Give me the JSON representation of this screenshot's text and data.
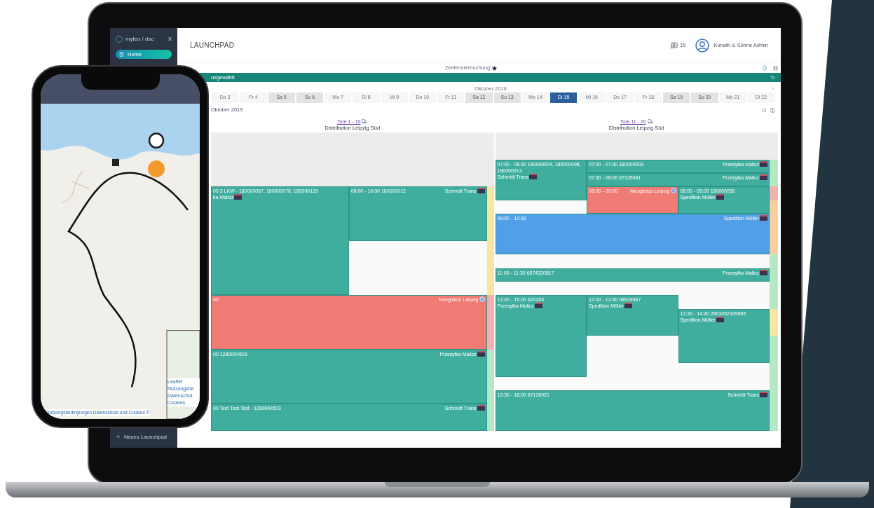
{
  "sidebar": {
    "logo": "myleo / dsc",
    "close": "X",
    "items": [
      {
        "label": "Home",
        "selected": true
      }
    ],
    "footer_action": "Neues Launchpad"
  },
  "header": {
    "title": "LAUNCHPAD",
    "messages": "15",
    "user": "Kunath & Söhne Admin"
  },
  "subheader": {
    "title": "Zeitfensterbuchung"
  },
  "filter_bar": {
    "text": "usgewählt"
  },
  "calendar": {
    "month": "Oktober 2019",
    "days": [
      {
        "label": "Do 3",
        "weekend": false,
        "selected": false
      },
      {
        "label": "Fr 4",
        "weekend": false,
        "selected": false
      },
      {
        "label": "Sa 5",
        "weekend": true,
        "selected": false
      },
      {
        "label": "So 6",
        "weekend": true,
        "selected": false
      },
      {
        "label": "Mo 7",
        "weekend": false,
        "selected": false
      },
      {
        "label": "Di 8",
        "weekend": false,
        "selected": false
      },
      {
        "label": "Mi 9",
        "weekend": false,
        "selected": false
      },
      {
        "label": "Do 10",
        "weekend": false,
        "selected": false
      },
      {
        "label": "Fr 11",
        "weekend": false,
        "selected": false
      },
      {
        "label": "Sa 12",
        "weekend": true,
        "selected": false
      },
      {
        "label": "So 13",
        "weekend": true,
        "selected": false
      },
      {
        "label": "Mo 14",
        "weekend": false,
        "selected": false
      },
      {
        "label": "Di 15",
        "weekend": false,
        "selected": true
      },
      {
        "label": "Mi 16",
        "weekend": false,
        "selected": false
      },
      {
        "label": "Do 17",
        "weekend": false,
        "selected": false
      },
      {
        "label": "Fr 18",
        "weekend": false,
        "selected": false
      },
      {
        "label": "Sa 19",
        "weekend": true,
        "selected": false
      },
      {
        "label": "So 20",
        "weekend": true,
        "selected": false
      },
      {
        "label": "Mo 21",
        "weekend": false,
        "selected": false
      },
      {
        "label": "Di 22",
        "weekend": false,
        "selected": false
      }
    ]
  },
  "schedule": {
    "date_label": "Oktober 2019",
    "columns": [
      {
        "gates": "Tore 1 - 10",
        "site": "Distribution Leipzig Süd",
        "events": [
          {
            "kind": "booked",
            "text": "00 3 LKW - 180000067, 180000078, 180000129",
            "carrier": "ka Malicz"
          },
          {
            "kind": "booked",
            "text": "08:00 - 10:00 180000012",
            "carrier": "Schmidt Trans"
          },
          {
            "kind": "blocked",
            "text": "00",
            "carrier": "Neogistics Leipzig"
          },
          {
            "kind": "booked",
            "text": "00 1280004503",
            "carrier": "Przesyłka Malicz"
          },
          {
            "kind": "booked",
            "text": "00 Test Test Test - 1280004503",
            "carrier": "Schmidt Trans"
          }
        ],
        "capacity": [
          {
            "color": "#f7e6a0"
          },
          {
            "color": "#f2b0b0"
          },
          {
            "color": "#b5e8c4"
          }
        ]
      },
      {
        "gates": "Tore 11 - 20",
        "site": "Distribution Leipzig Süd",
        "events": [
          {
            "kind": "booked",
            "text": "07:00 - 08:30 180000004, 180000098, 180000013",
            "carrier": "Schmidt Trans"
          },
          {
            "kind": "booked",
            "text": "07:00 - 07:30 180000003",
            "carrier": "Przesyłka Malicz"
          },
          {
            "kind": "booked",
            "text": "07:30 - 08:00 67125541",
            "carrier": "Przesyłka Malicz"
          },
          {
            "kind": "blocked",
            "text": "08:00 - 09:00",
            "carrier": "Neogistics Leipzig"
          },
          {
            "kind": "booked",
            "text": "08:00 - 09:00 180000056",
            "carrier": "Spedition Müller"
          },
          {
            "kind": "reserved",
            "text": "09:00 - 10:30",
            "carrier": "Spedition Müller"
          },
          {
            "kind": "booked",
            "text": "11:00 - 11:30 6574320817",
            "carrier": "Przesyłka Malicz"
          },
          {
            "kind": "booked",
            "text": "12:00 - 15:00 620335",
            "carrier": "Przesyłka Malicz"
          },
          {
            "kind": "booked",
            "text": "12:00 - 12:30 08919967",
            "carrier": "Spedition Müller"
          },
          {
            "kind": "booked",
            "text": "12:30 - 14:30 2803452345685",
            "carrier": "Spedition Müller"
          },
          {
            "kind": "booked",
            "text": "15:30 - 18:00 67128921",
            "carrier": "Schmidt Trans"
          }
        ],
        "capacity": [
          {
            "color": "#b5e8c4"
          },
          {
            "color": "#f2b0b0"
          },
          {
            "color": "#f8cfa0"
          },
          {
            "color": "#b5e8c4"
          },
          {
            "color": "#f7e6a0"
          },
          {
            "color": "#b5e8c4"
          }
        ]
      }
    ]
  },
  "phone": {
    "attribution": "Nutzungsbedingungen Datenschutz und Cookies ©",
    "inset_links": [
      "Leaflet",
      "Nutzungsbe",
      "Datenschut",
      "Cookies"
    ]
  }
}
